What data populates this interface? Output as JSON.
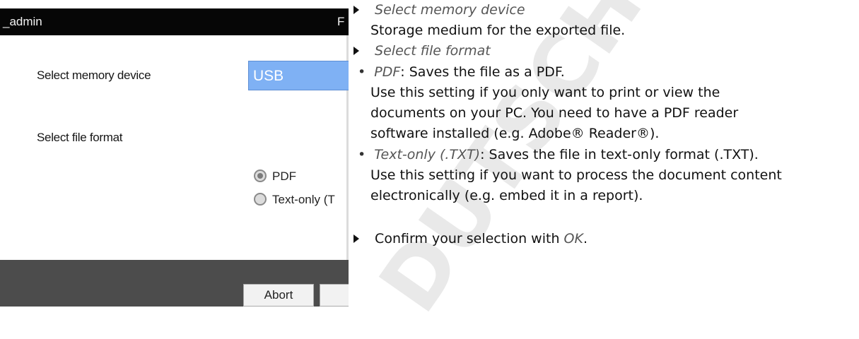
{
  "device": {
    "title": "_admin",
    "title_right": "F",
    "memory_label": "Select memory device",
    "memory_value": "USB",
    "format_label": "Select file format",
    "options": [
      {
        "label": "PDF",
        "checked": true
      },
      {
        "label": "Text-only (T",
        "checked": false
      }
    ],
    "abort_label": "Abort"
  },
  "manual": {
    "step1_title": "Select memory device",
    "step1_desc": "Storage medium for the exported file.",
    "step2_title": "Select file format",
    "pdf_term": "PDF",
    "pdf_desc": ": Saves the file as a PDF.",
    "pdf_more": [
      "Use this setting if you only want to print or view the",
      "documents on your PC. You need to have a PDF reader",
      "software installed (e.g. Adobe® Reader®)."
    ],
    "txt_term": "Text-only (.TXT)",
    "txt_desc": ": Saves the file in text-only format (.TXT).",
    "txt_more": [
      "Use this setting if you want to process the document content",
      "electronically (e.g. embed it in a report)."
    ],
    "confirm_prefix": "Confirm your selection with ",
    "confirm_ok": "OK",
    "confirm_suffix": "."
  },
  "watermark": {
    "text": "DUTSCHER",
    "color": "#e9e9e9"
  }
}
